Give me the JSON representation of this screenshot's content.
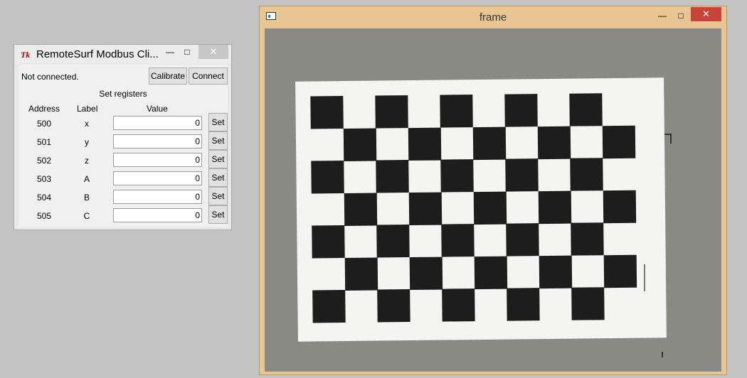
{
  "remote_window": {
    "title": "RemoteSurf Modbus Cli...",
    "icon": "tk-feather-icon",
    "status": "Not connected.",
    "buttons": {
      "calibrate": "Calibrate",
      "connect": "Connect"
    },
    "section_title": "Set registers",
    "headers": {
      "address": "Address",
      "label": "Label",
      "value": "Value"
    },
    "rows": [
      {
        "address": "500",
        "label": "x",
        "value": "0",
        "set": "Set"
      },
      {
        "address": "501",
        "label": "y",
        "value": "0",
        "set": "Set"
      },
      {
        "address": "502",
        "label": "z",
        "value": "0",
        "set": "Set"
      },
      {
        "address": "503",
        "label": "A",
        "value": "0",
        "set": "Set"
      },
      {
        "address": "504",
        "label": "B",
        "value": "0",
        "set": "Set"
      },
      {
        "address": "505",
        "label": "C",
        "value": "0",
        "set": "Set"
      }
    ]
  },
  "frame_window": {
    "title": "frame",
    "accent_color": "#e8c592",
    "close_color": "#c8443a"
  }
}
